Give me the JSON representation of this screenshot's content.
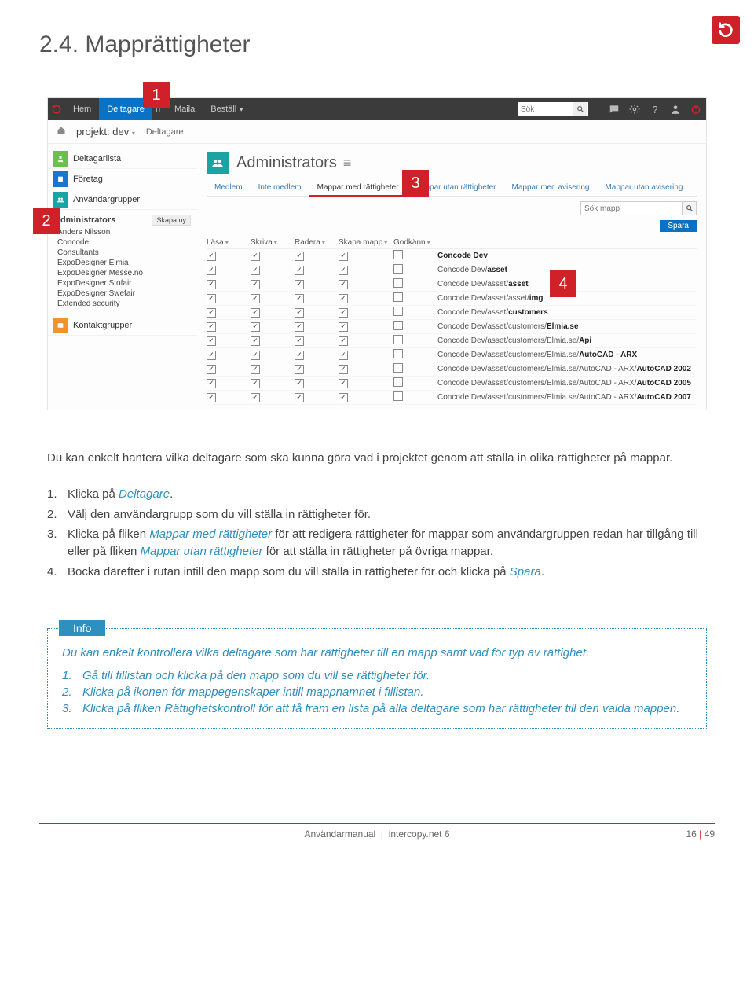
{
  "page": {
    "heading": "2.4. Mapprättigheter",
    "intro": "Du kan enkelt hantera vilka deltagare som ska kunna göra vad i projektet genom att ställa in olika rättigheter på mappar.",
    "steps": [
      {
        "n": "1.",
        "pre": "Klicka på ",
        "link": "Deltagare",
        "post": "."
      },
      {
        "n": "2.",
        "pre": "Välj den användargrupp som du vill ställa in rättigheter för.",
        "link": "",
        "post": ""
      },
      {
        "n": "3.",
        "pre": "Klicka på fliken ",
        "link": "Mappar med rättigheter",
        "mid": " för att redigera rättigheter för mappar som användar­gruppen redan har tillgång till eller på fliken ",
        "link2": "Mappar utan rättigheter",
        "post": " för att ställa in rättigheter på övriga mappar."
      },
      {
        "n": "4.",
        "pre": "Bocka därefter i rutan intill den mapp som du vill ställa in rättigheter för och klicka på ",
        "link": "Spara",
        "post": "."
      }
    ],
    "info": {
      "tag": "Info",
      "lead": "Du kan enkelt kontrollera vilka deltagare som har rättigheter till en mapp samt vad för typ av rättighet.",
      "items": [
        {
          "n": "1.",
          "t": "Gå till fillistan och klicka på den mapp som du vill se rättigheter för."
        },
        {
          "n": "2.",
          "t": "Klicka på ikonen för mappegenskaper intill mappnamnet i fillistan."
        },
        {
          "n": "3.",
          "t": "Klicka på fliken Rättighetskontroll för att få fram en lista på alla deltagare som har rättigheter till den valda mappen."
        }
      ]
    },
    "footer": {
      "left": "Användarmanual",
      "sep": "|",
      "prod": "intercopy.net 6",
      "page_cur": "16",
      "page_sep": "|",
      "page_tot": "49"
    },
    "markers": {
      "m1": "1",
      "m2": "2",
      "m3": "3",
      "m4": "4"
    }
  },
  "app": {
    "nav": [
      "Hem",
      "Deltagare",
      "n",
      "Maila",
      "Beställ"
    ],
    "nav_active_index": 1,
    "search_placeholder": "Sök",
    "projrow": {
      "label": "projekt: dev",
      "bc": "Deltagare"
    },
    "sidebar": {
      "items": [
        "Deltagarlista",
        "Företag",
        "Användargrupper"
      ],
      "groups_head": "Administrators",
      "skapa": "Skapa ny",
      "groups": [
        "Anders Nilsson",
        "Concode",
        "Consultants",
        "ExpoDesigner Elmia",
        "ExpoDesigner Messe.no",
        "ExpoDesigner Stofair",
        "ExpoDesigner Swefair",
        "Extended security"
      ],
      "contact": "Kontaktgrupper"
    },
    "main": {
      "title": "Administrators",
      "tabs": [
        "Medlem",
        "Inte medlem",
        "Mappar med rättigheter",
        "Mappar utan rättigheter",
        "Mappar med avisering",
        "Mappar utan avisering"
      ],
      "tab_active_index": 2,
      "search_placeholder": "Sök mapp",
      "save": "Spara",
      "perm_cols": [
        "Läsa",
        "Skriva",
        "Radera",
        "Skapa mapp",
        "Godkänn"
      ],
      "rows": [
        {
          "c": [
            true,
            true,
            true,
            true,
            false
          ],
          "plain": "",
          "bold": "Concode Dev"
        },
        {
          "c": [
            true,
            true,
            true,
            true,
            false
          ],
          "plain": "Concode Dev/",
          "bold": "asset"
        },
        {
          "c": [
            true,
            true,
            true,
            true,
            false
          ],
          "plain": "Concode Dev/asset/",
          "bold": "asset"
        },
        {
          "c": [
            true,
            true,
            true,
            true,
            false
          ],
          "plain": "Concode Dev/asset/asset/",
          "bold": "img"
        },
        {
          "c": [
            true,
            true,
            true,
            true,
            false
          ],
          "plain": "Concode Dev/asset/",
          "bold": "customers"
        },
        {
          "c": [
            true,
            true,
            true,
            true,
            false
          ],
          "plain": "Concode Dev/asset/customers/",
          "bold": "Elmia.se"
        },
        {
          "c": [
            true,
            true,
            true,
            true,
            false
          ],
          "plain": "Concode Dev/asset/customers/Elmia.se/",
          "bold": "Api"
        },
        {
          "c": [
            true,
            true,
            true,
            true,
            false
          ],
          "plain": "Concode Dev/asset/customers/Elmia.se/",
          "bold": "AutoCAD - ARX"
        },
        {
          "c": [
            true,
            true,
            true,
            true,
            false
          ],
          "plain": "Concode Dev/asset/customers/Elmia.se/AutoCAD - ARX/",
          "bold": "AutoCAD 2002"
        },
        {
          "c": [
            true,
            true,
            true,
            true,
            false
          ],
          "plain": "Concode Dev/asset/customers/Elmia.se/AutoCAD - ARX/",
          "bold": "AutoCAD 2005"
        },
        {
          "c": [
            true,
            true,
            true,
            true,
            false
          ],
          "plain": "Concode Dev/asset/customers/Elmia.se/AutoCAD - ARX/",
          "bold": "AutoCAD 2007"
        }
      ]
    }
  }
}
